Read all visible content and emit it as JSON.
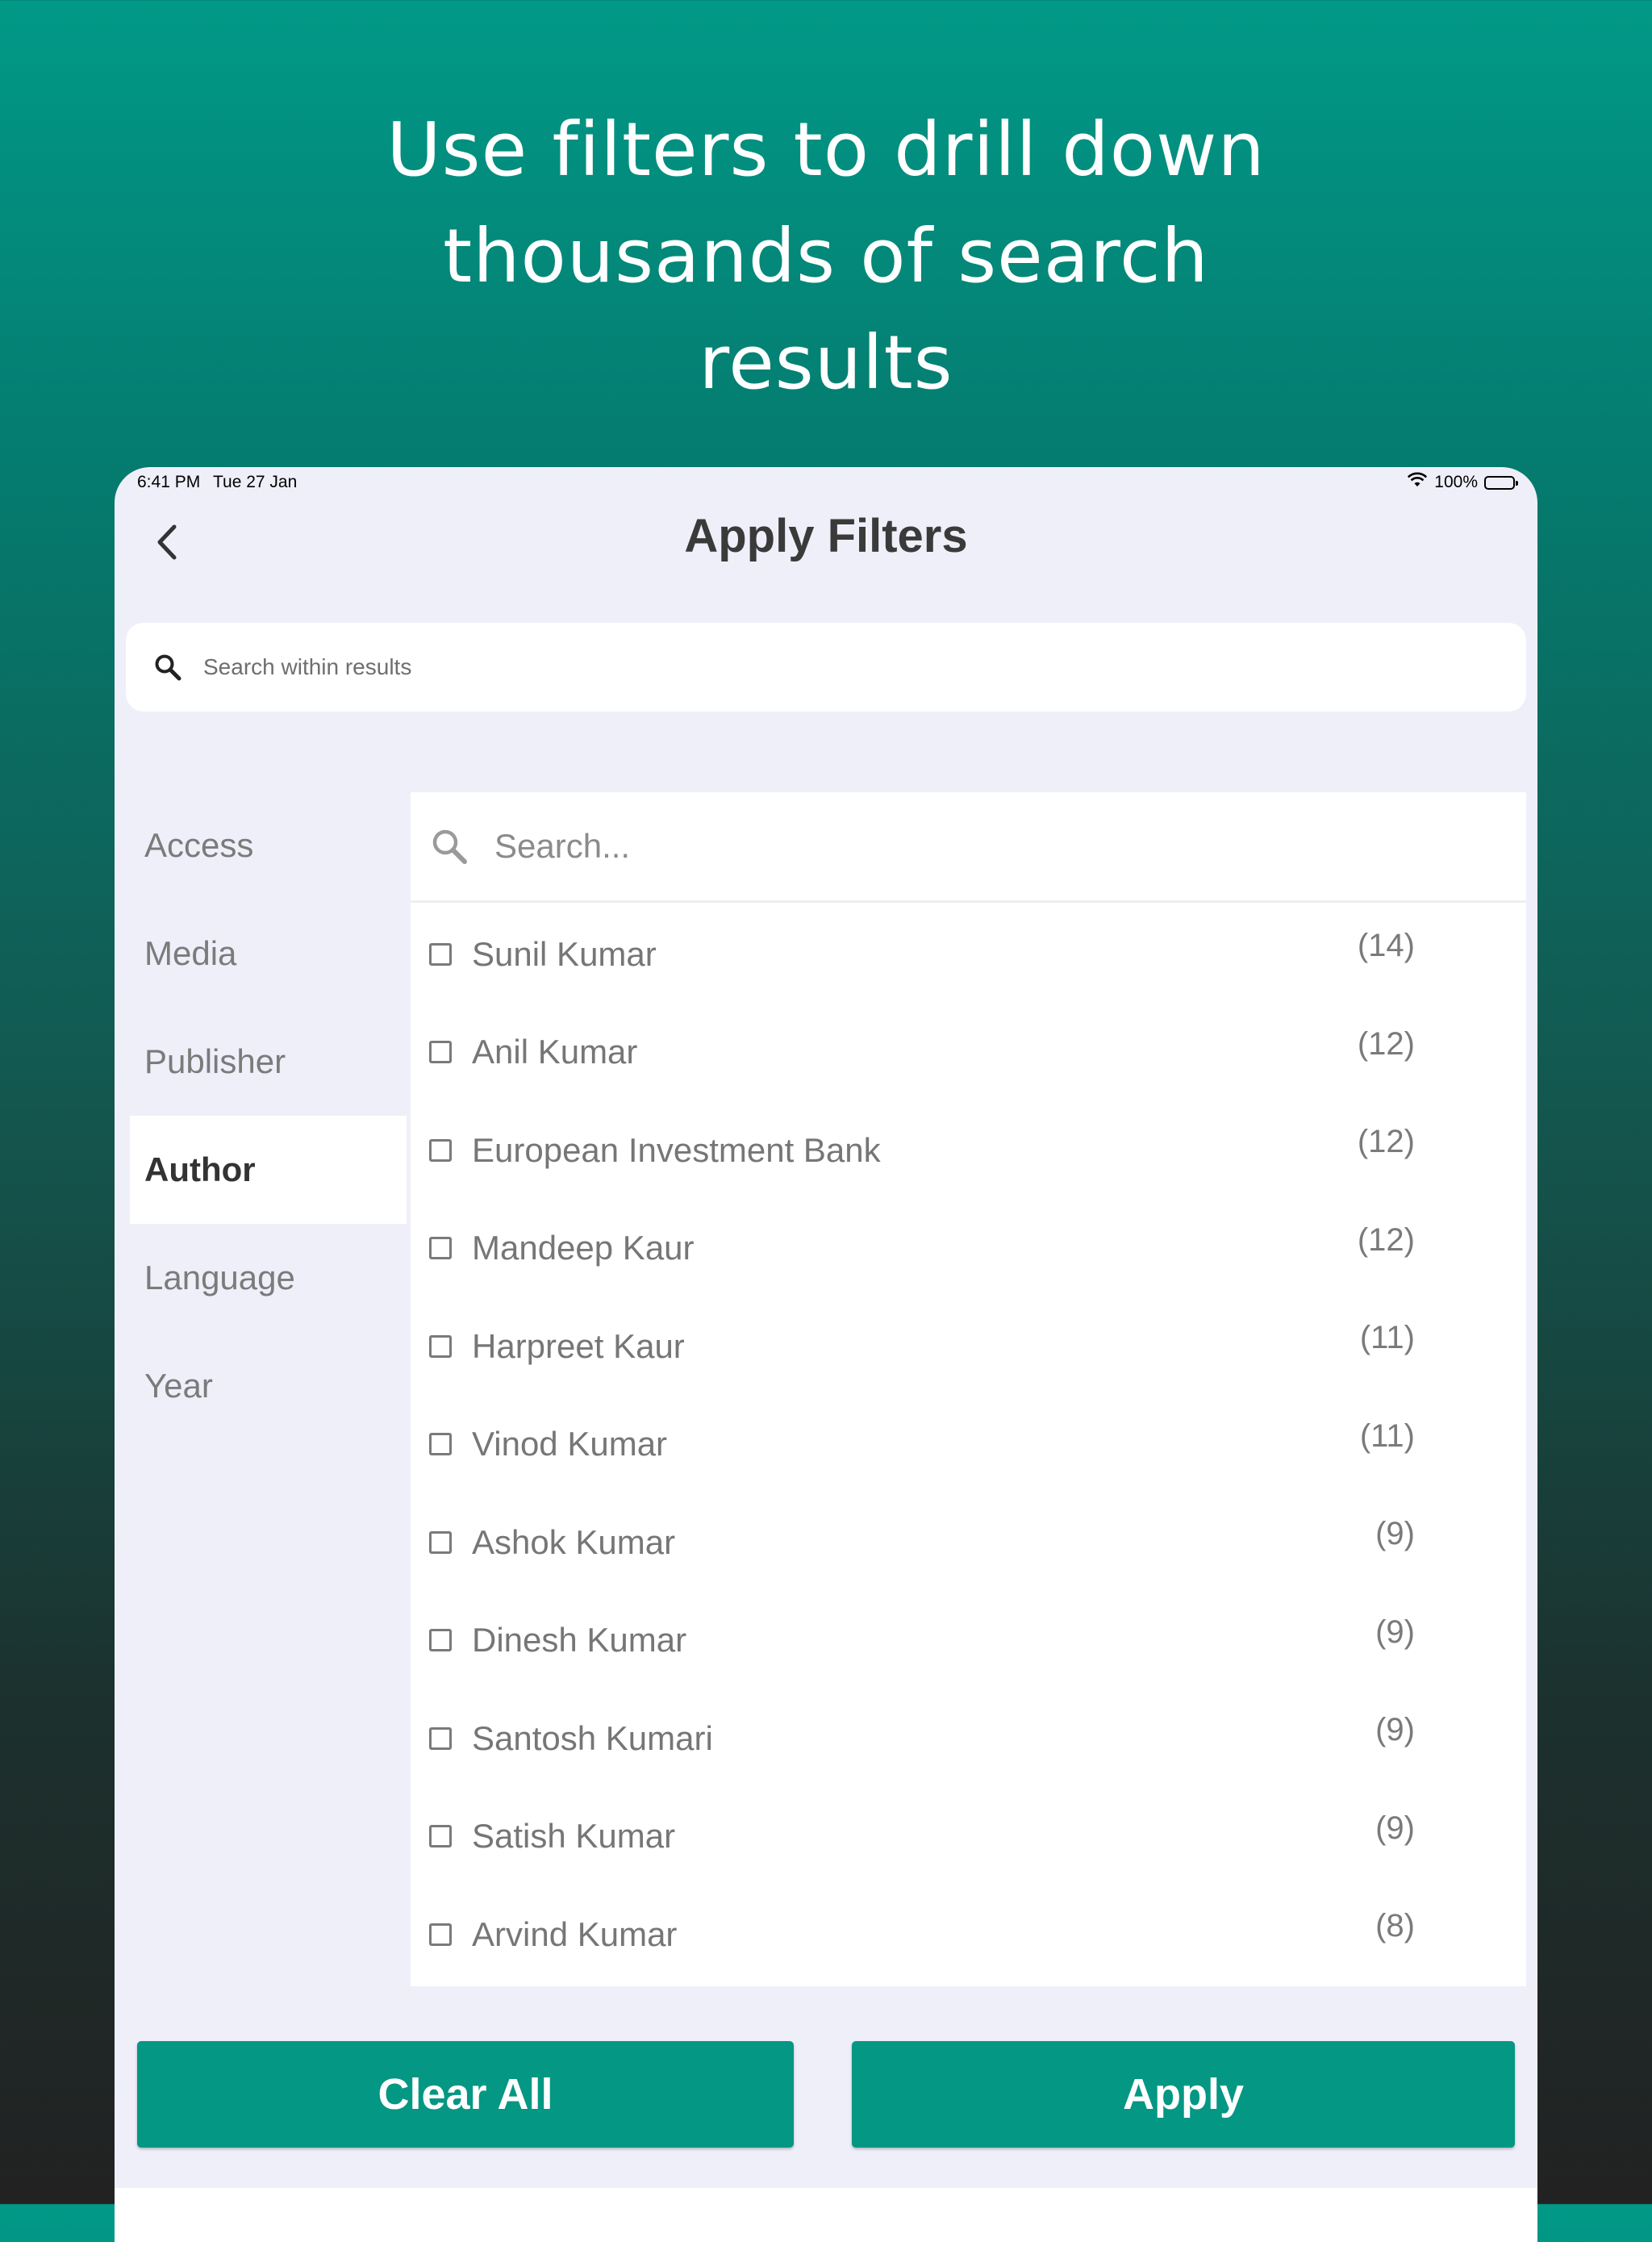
{
  "promo": {
    "line1": "Use filters to drill down",
    "line2": "thousands of search",
    "line3": "results"
  },
  "status_bar": {
    "time": "6:41 PM",
    "date": "Tue 27 Jan",
    "battery": "100%"
  },
  "header": {
    "title": "Apply Filters",
    "back_icon": "chevron-left-icon"
  },
  "search": {
    "placeholder": "Search within results",
    "icon": "search-icon"
  },
  "sidebar": {
    "items": [
      {
        "label": "Access"
      },
      {
        "label": "Media"
      },
      {
        "label": "Publisher"
      },
      {
        "label": "Author",
        "active": true
      },
      {
        "label": "Language"
      },
      {
        "label": "Year"
      }
    ]
  },
  "filter_panel": {
    "search_placeholder": "Search...",
    "options": [
      {
        "name": "Sunil Kumar",
        "count": "(14)"
      },
      {
        "name": "Anil Kumar",
        "count": "(12)"
      },
      {
        "name": "European Investment Bank",
        "count": "(12)"
      },
      {
        "name": "Mandeep Kaur",
        "count": "(12)"
      },
      {
        "name": "Harpreet Kaur",
        "count": "(11)"
      },
      {
        "name": "Vinod Kumar",
        "count": "(11)"
      },
      {
        "name": "Ashok Kumar",
        "count": "(9)"
      },
      {
        "name": "Dinesh Kumar",
        "count": "(9)"
      },
      {
        "name": "Santosh Kumari",
        "count": "(9)"
      },
      {
        "name": "Satish Kumar",
        "count": "(9)"
      },
      {
        "name": "Arvind Kumar",
        "count": "(8)"
      }
    ]
  },
  "actions": {
    "clear_label": "Clear All",
    "apply_label": "Apply"
  },
  "colors": {
    "accent": "#049784",
    "background_top": "#019987",
    "background_bottom": "#222222",
    "device_bg": "#efeffa"
  }
}
